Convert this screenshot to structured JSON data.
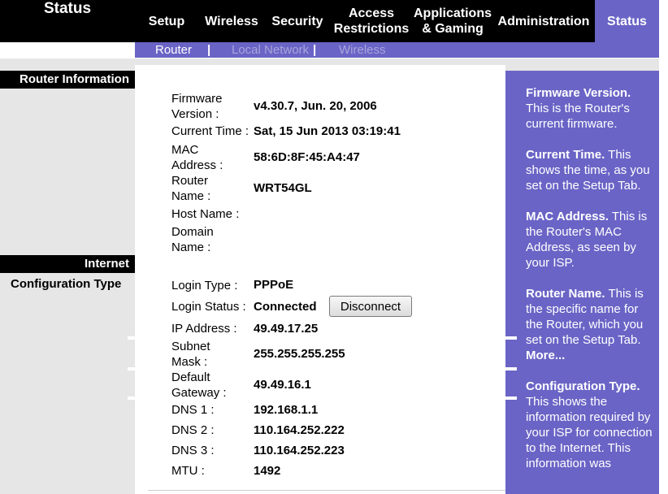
{
  "header": {
    "section_title": "Status"
  },
  "nav": {
    "setup": "Setup",
    "wireless": "Wireless",
    "security": "Security",
    "access_line1": "Access",
    "access_line2": "Restrictions",
    "apps_line1": "Applications",
    "apps_line2": "& Gaming",
    "administration": "Administration",
    "status": "Status"
  },
  "subnav": {
    "router": "Router",
    "local_network": "Local Network",
    "wireless": "Wireless",
    "separator": "|"
  },
  "left": {
    "router_information": "Router Information",
    "internet": "Internet",
    "configuration_type": "Configuration Type"
  },
  "router_info": {
    "firmware_label_1": "Firmware",
    "firmware_label_2": "Version :",
    "firmware_value": "v4.30.7, Jun. 20, 2006",
    "time_label": "Current Time :",
    "time_value": "Sat, 15 Jun 2013 03:19:41",
    "mac_label_1": "MAC",
    "mac_label_2": "Address :",
    "mac_value": "58:6D:8F:45:A4:47",
    "router_name_label_1": "Router",
    "router_name_label_2": "Name :",
    "router_name_value": "WRT54GL",
    "host_name_label": "Host Name :",
    "domain_label_1": "Domain",
    "domain_label_2": "Name :"
  },
  "internet": {
    "login_type_label": "Login Type :",
    "login_type_value": "PPPoE",
    "login_status_label": "Login Status :",
    "login_status_value": "Connected",
    "disconnect_button": "Disconnect",
    "ip_label": "IP Address :",
    "ip_value": "49.49.17.25",
    "subnet_label_1": "Subnet",
    "subnet_label_2": "Mask :",
    "subnet_value": "255.255.255.255",
    "gateway_label_1": "Default",
    "gateway_label_2": "Gateway :",
    "gateway_value": "49.49.16.1",
    "dns1_label": "DNS 1 :",
    "dns1_value": "192.168.1.1",
    "dns2_label": "DNS 2 :",
    "dns2_value": "110.164.252.222",
    "dns3_label": "DNS 3 :",
    "dns3_value": "110.164.252.223",
    "mtu_label": "MTU :",
    "mtu_value": "1492"
  },
  "help": {
    "firmware_title": "Firmware Version.",
    "firmware_text": "This is the Router's current firmware.",
    "time_title": "Current Time.",
    "time_text": "This shows the time, as you set on the Setup Tab.",
    "mac_title": "MAC Address.",
    "mac_text": "This is the Router's MAC Address, as seen by your ISP.",
    "router_name_title": "Router Name.",
    "router_name_text": "This is the specific name for the Router, which you set on the Setup Tab.",
    "more_link": "More...",
    "config_title": "Configuration Type.",
    "config_text": "This shows the information required by your ISP for connection to the Internet. This information was"
  },
  "colors": {
    "accent": "#6a64c6",
    "header_bg": "#000000",
    "sidebar_bg": "#e6e6e6",
    "subnav_active": "#ffffff",
    "subnav_inactive": "#a9a5dc"
  }
}
